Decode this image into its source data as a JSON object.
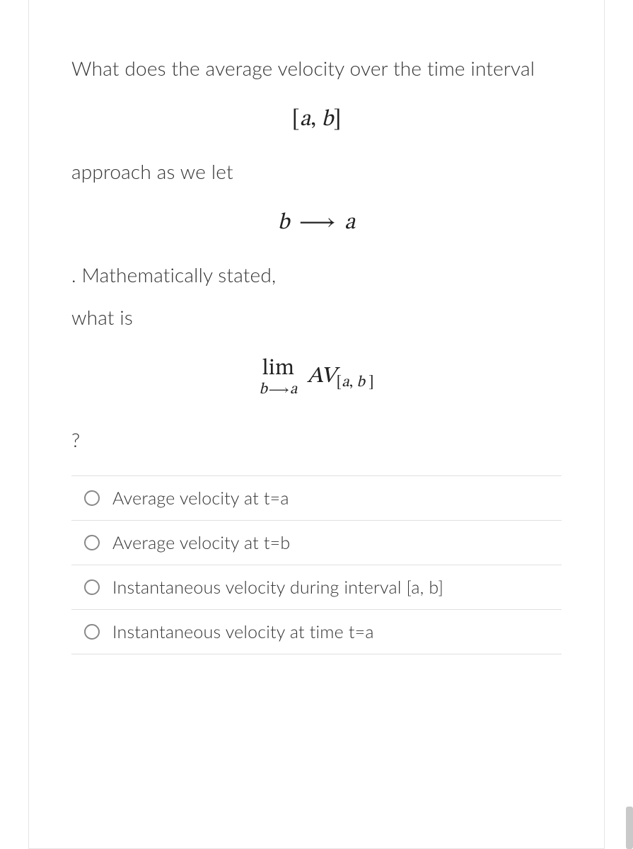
{
  "question": {
    "line1": "What does the average velocity over the time interval",
    "math1_bracket_ab": "[a, b]",
    "line2": "approach as we let",
    "math2_b": "b",
    "math2_arrow": "⟶",
    "math2_a": "a",
    "line3": ". Mathematically stated,",
    "line4": "what is",
    "math3_lim": "lim",
    "math3_sub_b": "b",
    "math3_sub_arrow": "⟶",
    "math3_sub_a": "a",
    "math3_AV": "AV",
    "math3_sub_brackets": "[a, b ]",
    "line5": "?"
  },
  "options": [
    {
      "label": "Average velocity at t=a"
    },
    {
      "label": "Average velocity at t=b"
    },
    {
      "label": "Instantaneous velocity during interval [a, b]"
    },
    {
      "label": "Instantaneous velocity at time t=a"
    }
  ]
}
